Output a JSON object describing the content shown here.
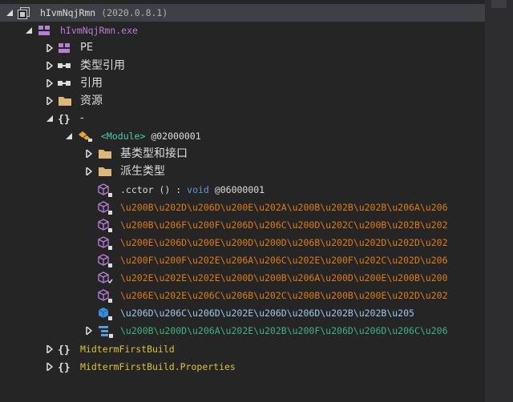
{
  "colors": {
    "background": "#252526",
    "text": "#dcdcdc",
    "assembly": "#b87fd8",
    "type": "#4ec9b0",
    "namespace_type": "#d8c23a",
    "field": "#e07b14",
    "method_keyword": "#5b9bd5",
    "nested_type": "#3fb37f"
  },
  "tree": {
    "root": {
      "name": "hIvmNqjRmn",
      "version": "(2020.0.8.1)"
    },
    "module": {
      "label": "hIvmNqjRmn.exe"
    },
    "pe": {
      "label": "PE"
    },
    "type_refs": {
      "label": "类型引用"
    },
    "refs": {
      "label": "引用"
    },
    "resources": {
      "label": "资源"
    },
    "namespace_root": {
      "label": "-"
    },
    "module_type": {
      "name": "<Module>",
      "token": "@02000001"
    },
    "base_types": {
      "label": "基类型和接口"
    },
    "derived_types": {
      "label": "派生类型"
    },
    "cctor": {
      "name": ".cctor",
      "parens": "()",
      "colon": ":",
      "type": "void",
      "token": "@06000001"
    },
    "fields": [
      "\\u200B\\u202D\\u206D\\u200E\\u202A\\u200B\\u202B\\u202B\\u206A\\u206",
      "\\u200B\\u206F\\u200F\\u206D\\u206C\\u200D\\u202C\\u200B\\u202B\\u202",
      "\\u200E\\u206D\\u200E\\u200D\\u200D\\u206B\\u202D\\u202D\\u202D\\u202",
      "\\u200F\\u200F\\u202E\\u206A\\u206C\\u202E\\u200F\\u202C\\u202D\\u206",
      "\\u202E\\u202E\\u202E\\u200D\\u200B\\u206A\\u200D\\u200E\\u200B\\u200",
      "\\u206E\\u202E\\u206C\\u206B\\u202C\\u200B\\u200B\\u200E\\u202D\\u202"
    ],
    "method_last": "\\u206D\\u206C\\u206D\\u202E\\u206D\\u206D\\u202B\\u202B\\u205",
    "nested_type": "\\u200B\\u200D\\u206A\\u202E\\u202B\\u200F\\u206D\\u206D\\u206C\\u206",
    "ns1": {
      "label": "MidtermFirstBuild"
    },
    "ns2": {
      "label": "MidtermFirstBuild.Properties"
    }
  }
}
